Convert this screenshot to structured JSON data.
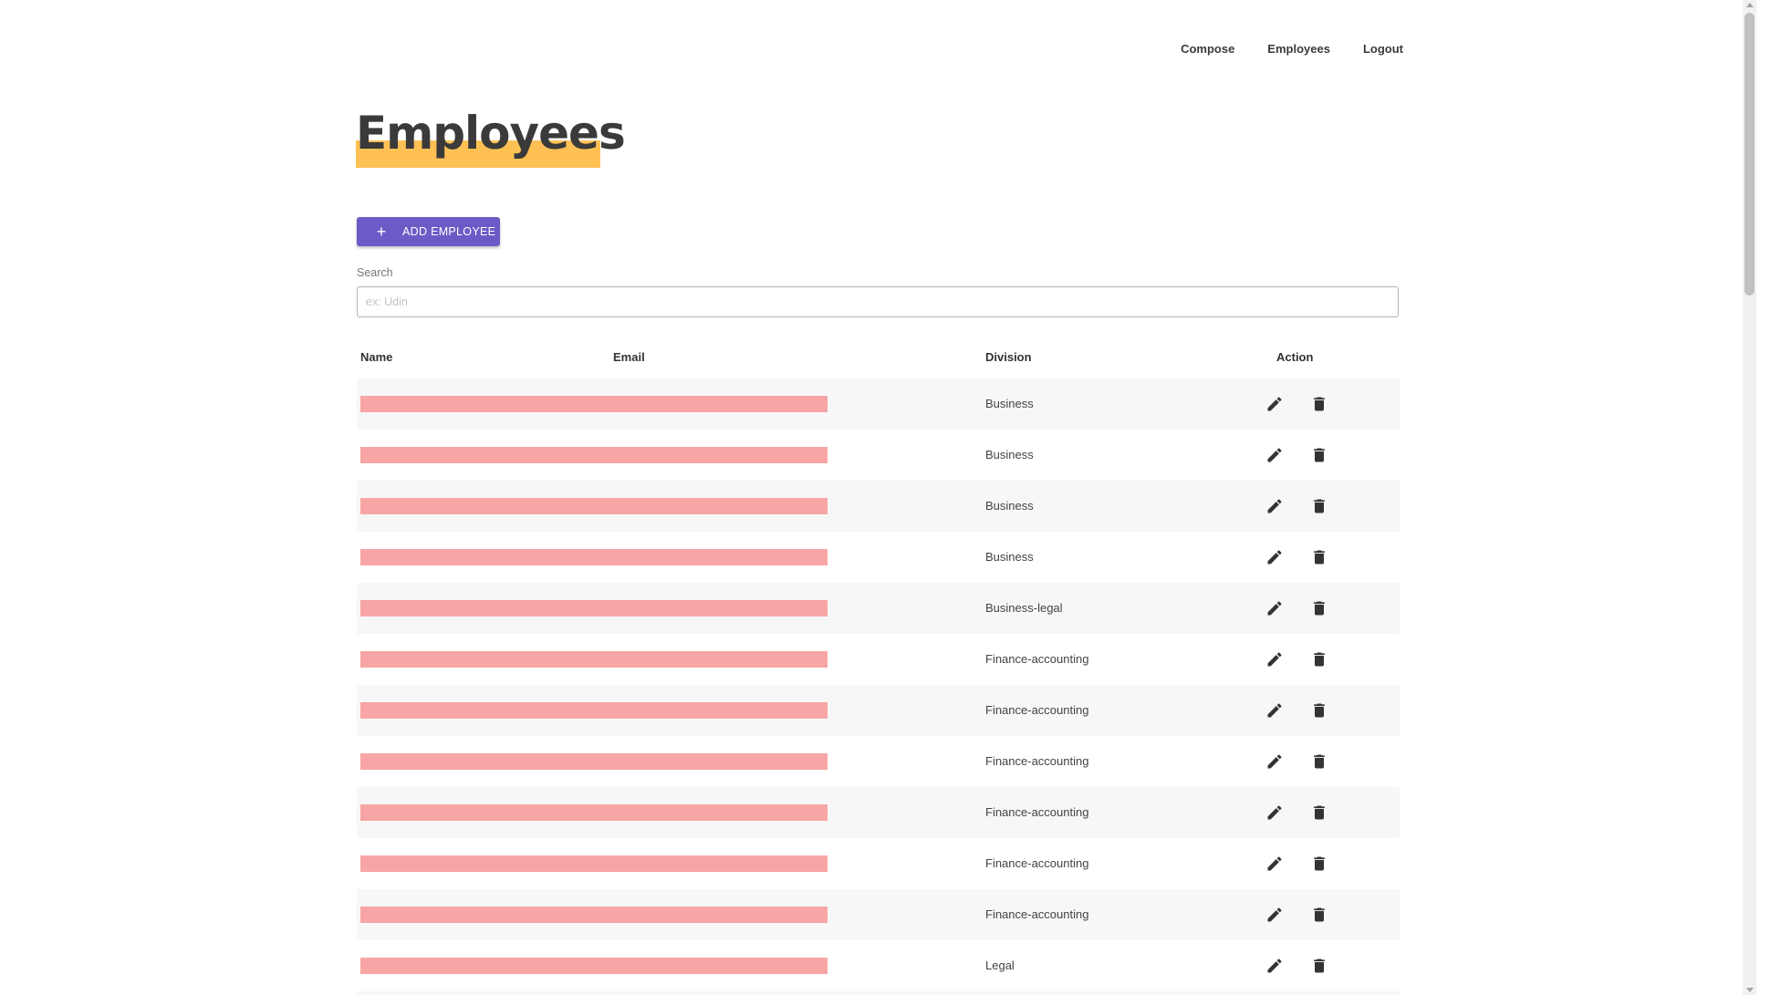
{
  "nav": {
    "items": [
      "Compose",
      "Employees",
      "Logout"
    ]
  },
  "page_title": "Employees",
  "add_button": {
    "label": "ADD EMPLOYEE",
    "icon": "plus-icon"
  },
  "search": {
    "label": "Search",
    "placeholder": "ex: Udin",
    "value": ""
  },
  "table": {
    "columns": {
      "name": "Name",
      "email": "Email",
      "division": "Division",
      "action": "Action"
    },
    "rows": [
      {
        "division": "Business"
      },
      {
        "division": "Business"
      },
      {
        "division": "Business"
      },
      {
        "division": "Business"
      },
      {
        "division": "Business-legal"
      },
      {
        "division": "Finance-accounting"
      },
      {
        "division": "Finance-accounting"
      },
      {
        "division": "Finance-accounting"
      },
      {
        "division": "Finance-accounting"
      },
      {
        "division": "Finance-accounting"
      },
      {
        "division": "Finance-accounting"
      },
      {
        "division": "Legal"
      },
      {
        "division": ""
      }
    ],
    "row_icons": {
      "edit": "pencil-icon",
      "delete": "trash-icon"
    }
  },
  "colors": {
    "accent": "#6a5bc7",
    "title_highlight": "#ffc154",
    "redaction": "#f8a5a5",
    "row_stripe": "#f7f7f7"
  }
}
